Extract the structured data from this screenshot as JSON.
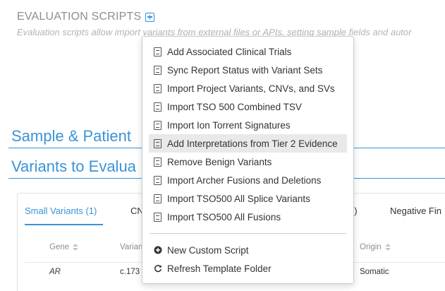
{
  "section": {
    "title": "EVALUATION SCRIPTS",
    "add_icon": "plus-square-icon",
    "description": "Evaluation scripts allow import variants from external files or APIs, setting sample fields and autor"
  },
  "headings": {
    "sample_patient": "Sample & Patient",
    "variants_to_evaluate": "Variants to Evalua"
  },
  "tabs": {
    "active": "Small Variants (1)",
    "cnv": "CN",
    "other_count": "0)",
    "negative": "Negative Fin"
  },
  "table": {
    "columns": {
      "gene": "Gene",
      "variant": "Varian",
      "origin": "Origin"
    },
    "rows": [
      {
        "gene": "AR",
        "variant": "c.173",
        "origin": "Somatic"
      }
    ]
  },
  "menu": {
    "items": [
      {
        "label": "Add Associated Clinical Trials",
        "icon": "file-code-icon"
      },
      {
        "label": "Sync Report Status with Variant Sets",
        "icon": "file-code-icon"
      },
      {
        "label": "Import Project Variants, CNVs, and SVs",
        "icon": "file-code-icon"
      },
      {
        "label": "Import TSO 500 Combined TSV",
        "icon": "file-code-icon"
      },
      {
        "label": "Import Ion Torrent Signatures",
        "icon": "file-code-icon"
      },
      {
        "label": "Add Interpretations from Tier 2 Evidence",
        "icon": "file-code-icon",
        "highlighted": true
      },
      {
        "label": "Remove Benign Variants",
        "icon": "file-code-icon"
      },
      {
        "label": "Import Archer Fusions and Deletions",
        "icon": "file-code-icon"
      },
      {
        "label": "Import TSO500 All Splice Variants",
        "icon": "file-code-icon"
      },
      {
        "label": "Import TSO500 All Fusions",
        "icon": "file-code-icon"
      }
    ],
    "actions": [
      {
        "label": "New Custom Script",
        "icon": "plus-circle-icon"
      },
      {
        "label": "Refresh Template Folder",
        "icon": "refresh-icon"
      }
    ]
  },
  "colors": {
    "accent": "#3a93d6",
    "muted_text": "#8a8f94",
    "menu_highlight": "#e8e9eb"
  }
}
